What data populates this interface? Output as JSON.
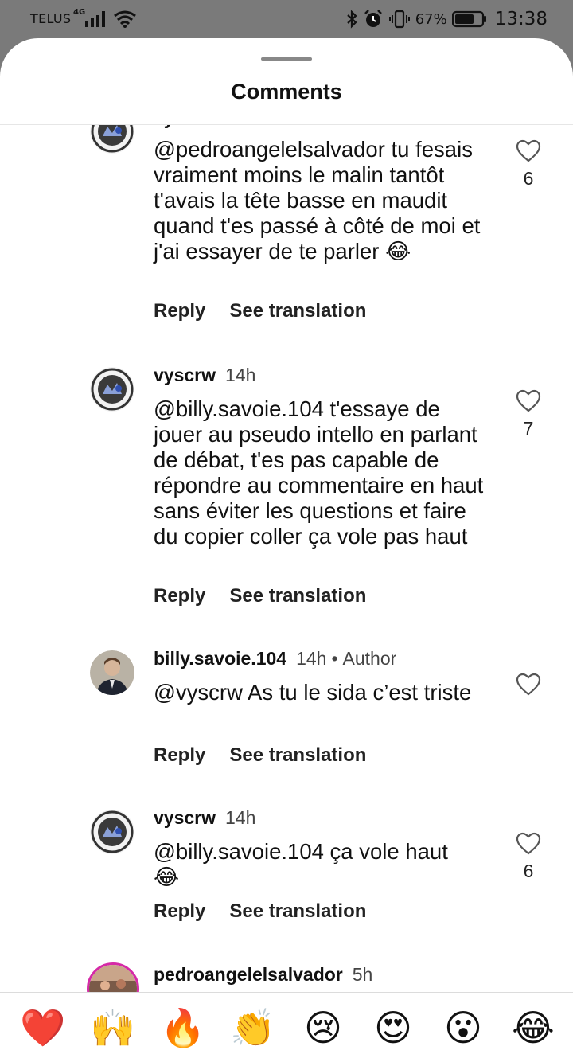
{
  "status_bar": {
    "carrier": "TELUS",
    "network": "4G",
    "battery_percent": "67%",
    "time": "13:38"
  },
  "sheet": {
    "title": "Comments"
  },
  "comments": [
    {
      "username": "vyscrw",
      "time": "",
      "text": "@pedroangelelsalvador tu fesais vraiment moins le malin tantôt t'avais la tête basse en maudit quand t'es passé à côté de moi et j'ai essayer de te parler 😂",
      "reply_label": "Reply",
      "translate_label": "See translation",
      "likes": "6"
    },
    {
      "username": "vyscrw",
      "time": "14h",
      "text": "@billy.savoie.104 t'essaye de jouer au pseudo intello en parlant de débat, t'es pas capable de répondre au commentaire en haut sans éviter les questions et faire du copier coller ça vole pas haut",
      "reply_label": "Reply",
      "translate_label": "See translation",
      "likes": "7"
    },
    {
      "username": "billy.savoie.104",
      "time": "14h",
      "author_badge": "Author",
      "text": "@vyscrw As tu le sida c’est triste",
      "reply_label": "Reply",
      "translate_label": "See translation",
      "likes": ""
    },
    {
      "username": "vyscrw",
      "time": "14h",
      "text": "@billy.savoie.104 ça vole haut 😂",
      "reply_label": "Reply",
      "translate_label": "See translation",
      "likes": "6"
    },
    {
      "username": "pedroangelelsalvador",
      "time": "5h"
    }
  ],
  "emoji_bar": {
    "emojis": [
      "❤️",
      "🙌",
      "🔥",
      "👏",
      "😢",
      "😍",
      "😮",
      "😂"
    ]
  }
}
